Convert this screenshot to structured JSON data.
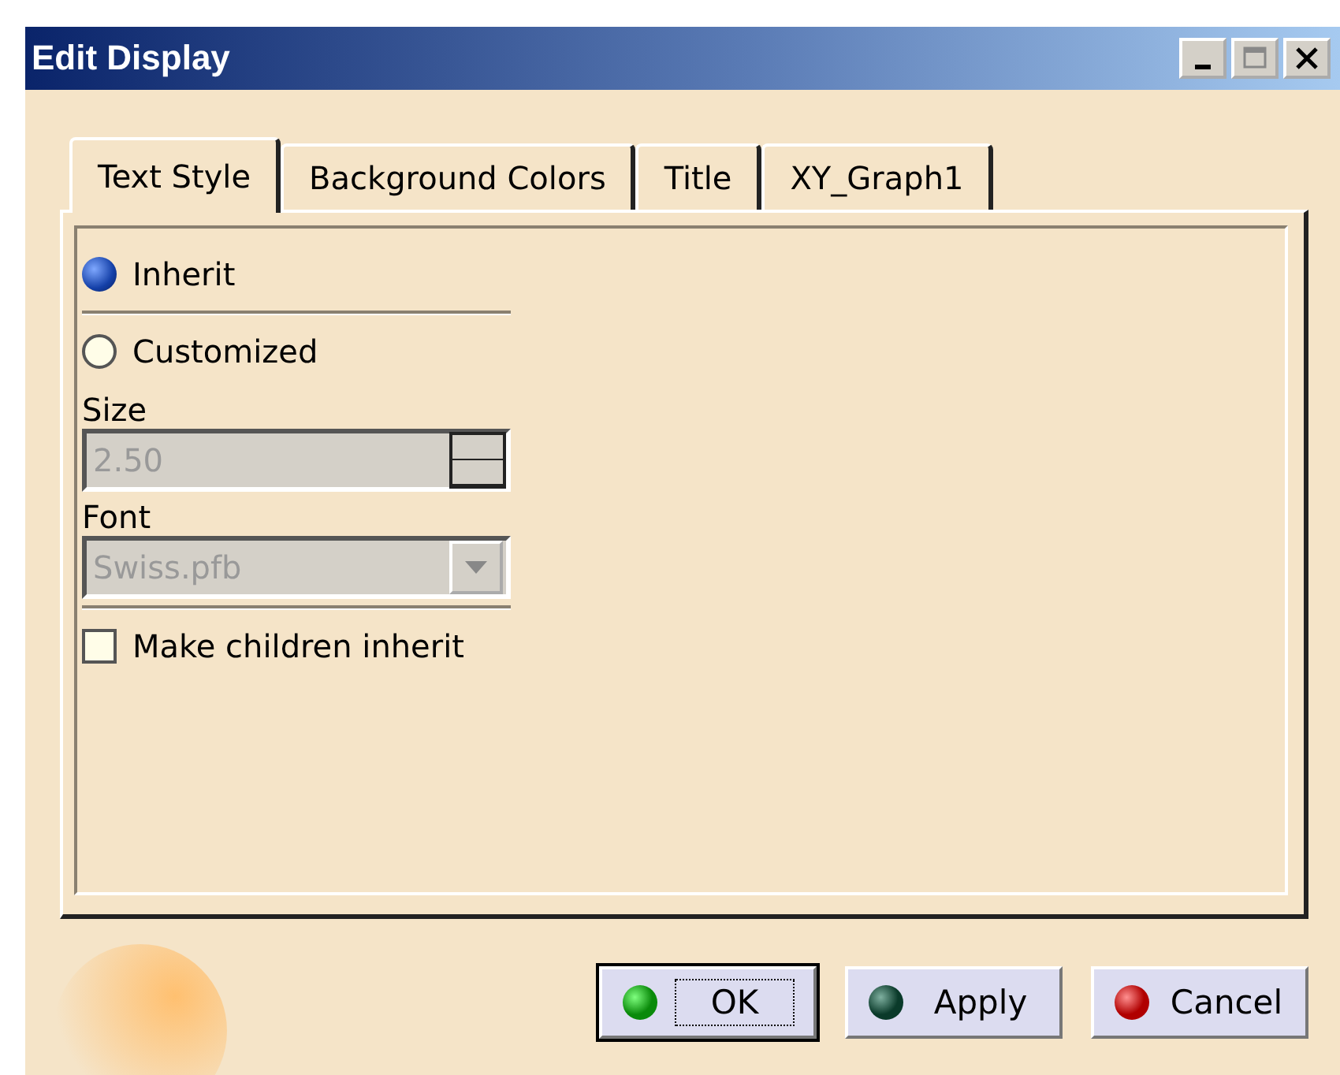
{
  "window": {
    "title": "Edit Display"
  },
  "tabs": [
    {
      "label": "Text Style",
      "selected": true
    },
    {
      "label": "Background Colors",
      "selected": false
    },
    {
      "label": "Title",
      "selected": false
    },
    {
      "label": "XY_Graph1",
      "selected": false
    }
  ],
  "options": [
    {
      "label": "Inherit",
      "selected": true
    },
    {
      "label": "Customized",
      "selected": false
    }
  ],
  "size": {
    "label": "Size",
    "value": "2.50",
    "disabled": true
  },
  "font": {
    "label": "Font",
    "value": "Swiss.pfb",
    "disabled": true
  },
  "make_children_inherit": {
    "label": "Make children inherit",
    "checked": false
  },
  "buttons": [
    {
      "label": "OK",
      "kind": "ok",
      "default": true
    },
    {
      "label": "Apply",
      "kind": "apply",
      "default": false
    },
    {
      "label": "Cancel",
      "kind": "cancel",
      "default": false
    }
  ]
}
